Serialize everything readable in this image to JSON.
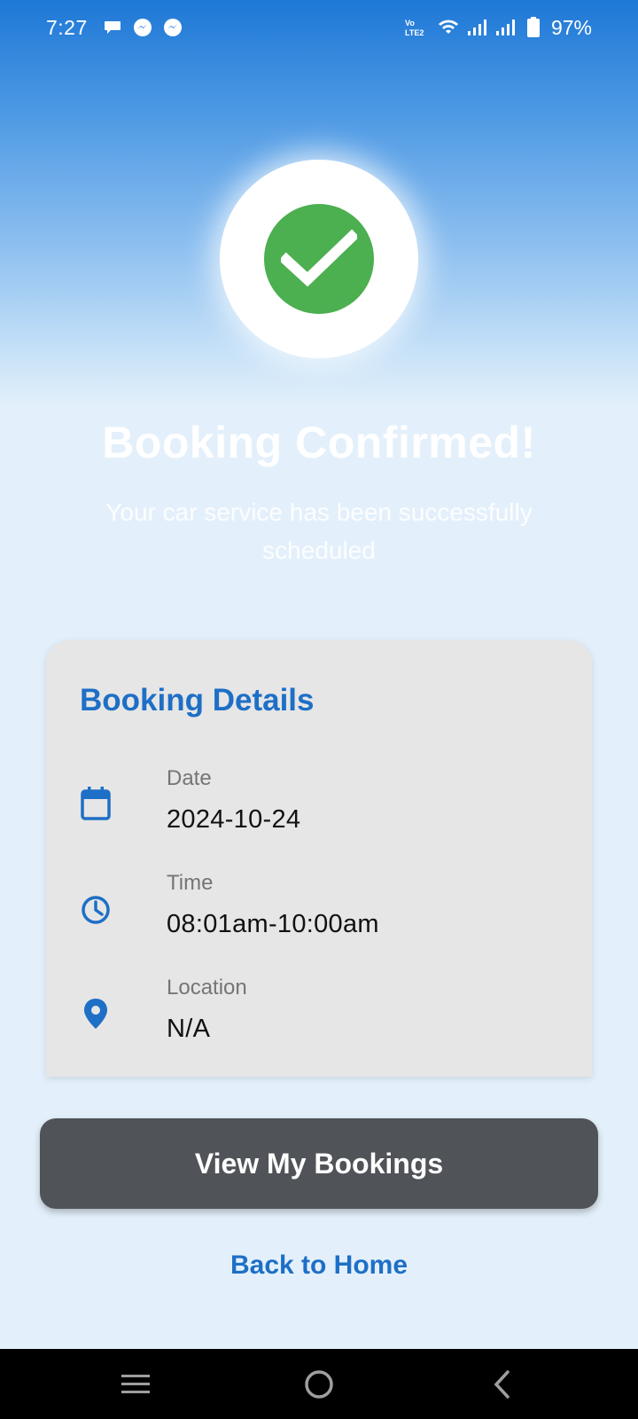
{
  "status_bar": {
    "time": "7:27",
    "battery": "97%",
    "icons": [
      "chat-bubble-icon",
      "messenger-icon",
      "messenger-icon",
      "volte-icon",
      "wifi-icon",
      "signal-icon",
      "signal-icon",
      "battery-icon"
    ],
    "volte_text": "LTE2"
  },
  "header": {
    "status_icon": "check-circle-icon",
    "title": "Booking Confirmed!",
    "subtitle": "Your car service has been successfully scheduled"
  },
  "details_card": {
    "title": "Booking Details",
    "rows": [
      {
        "icon": "calendar-icon",
        "label": "Date",
        "value": "2024-10-24"
      },
      {
        "icon": "clock-icon",
        "label": "Time",
        "value": "08:01am-10:00am"
      },
      {
        "icon": "location-pin-icon",
        "label": "Location",
        "value": "N/A"
      }
    ]
  },
  "actions": {
    "primary_label": "View My Bookings",
    "secondary_label": "Back to Home"
  },
  "nav_bar": {
    "icons": [
      "recent-apps-icon",
      "home-icon",
      "back-icon"
    ]
  },
  "colors": {
    "accent": "#1e6fc6",
    "success": "#4caf50",
    "button": "#505357",
    "card": "#e6e6e6"
  }
}
